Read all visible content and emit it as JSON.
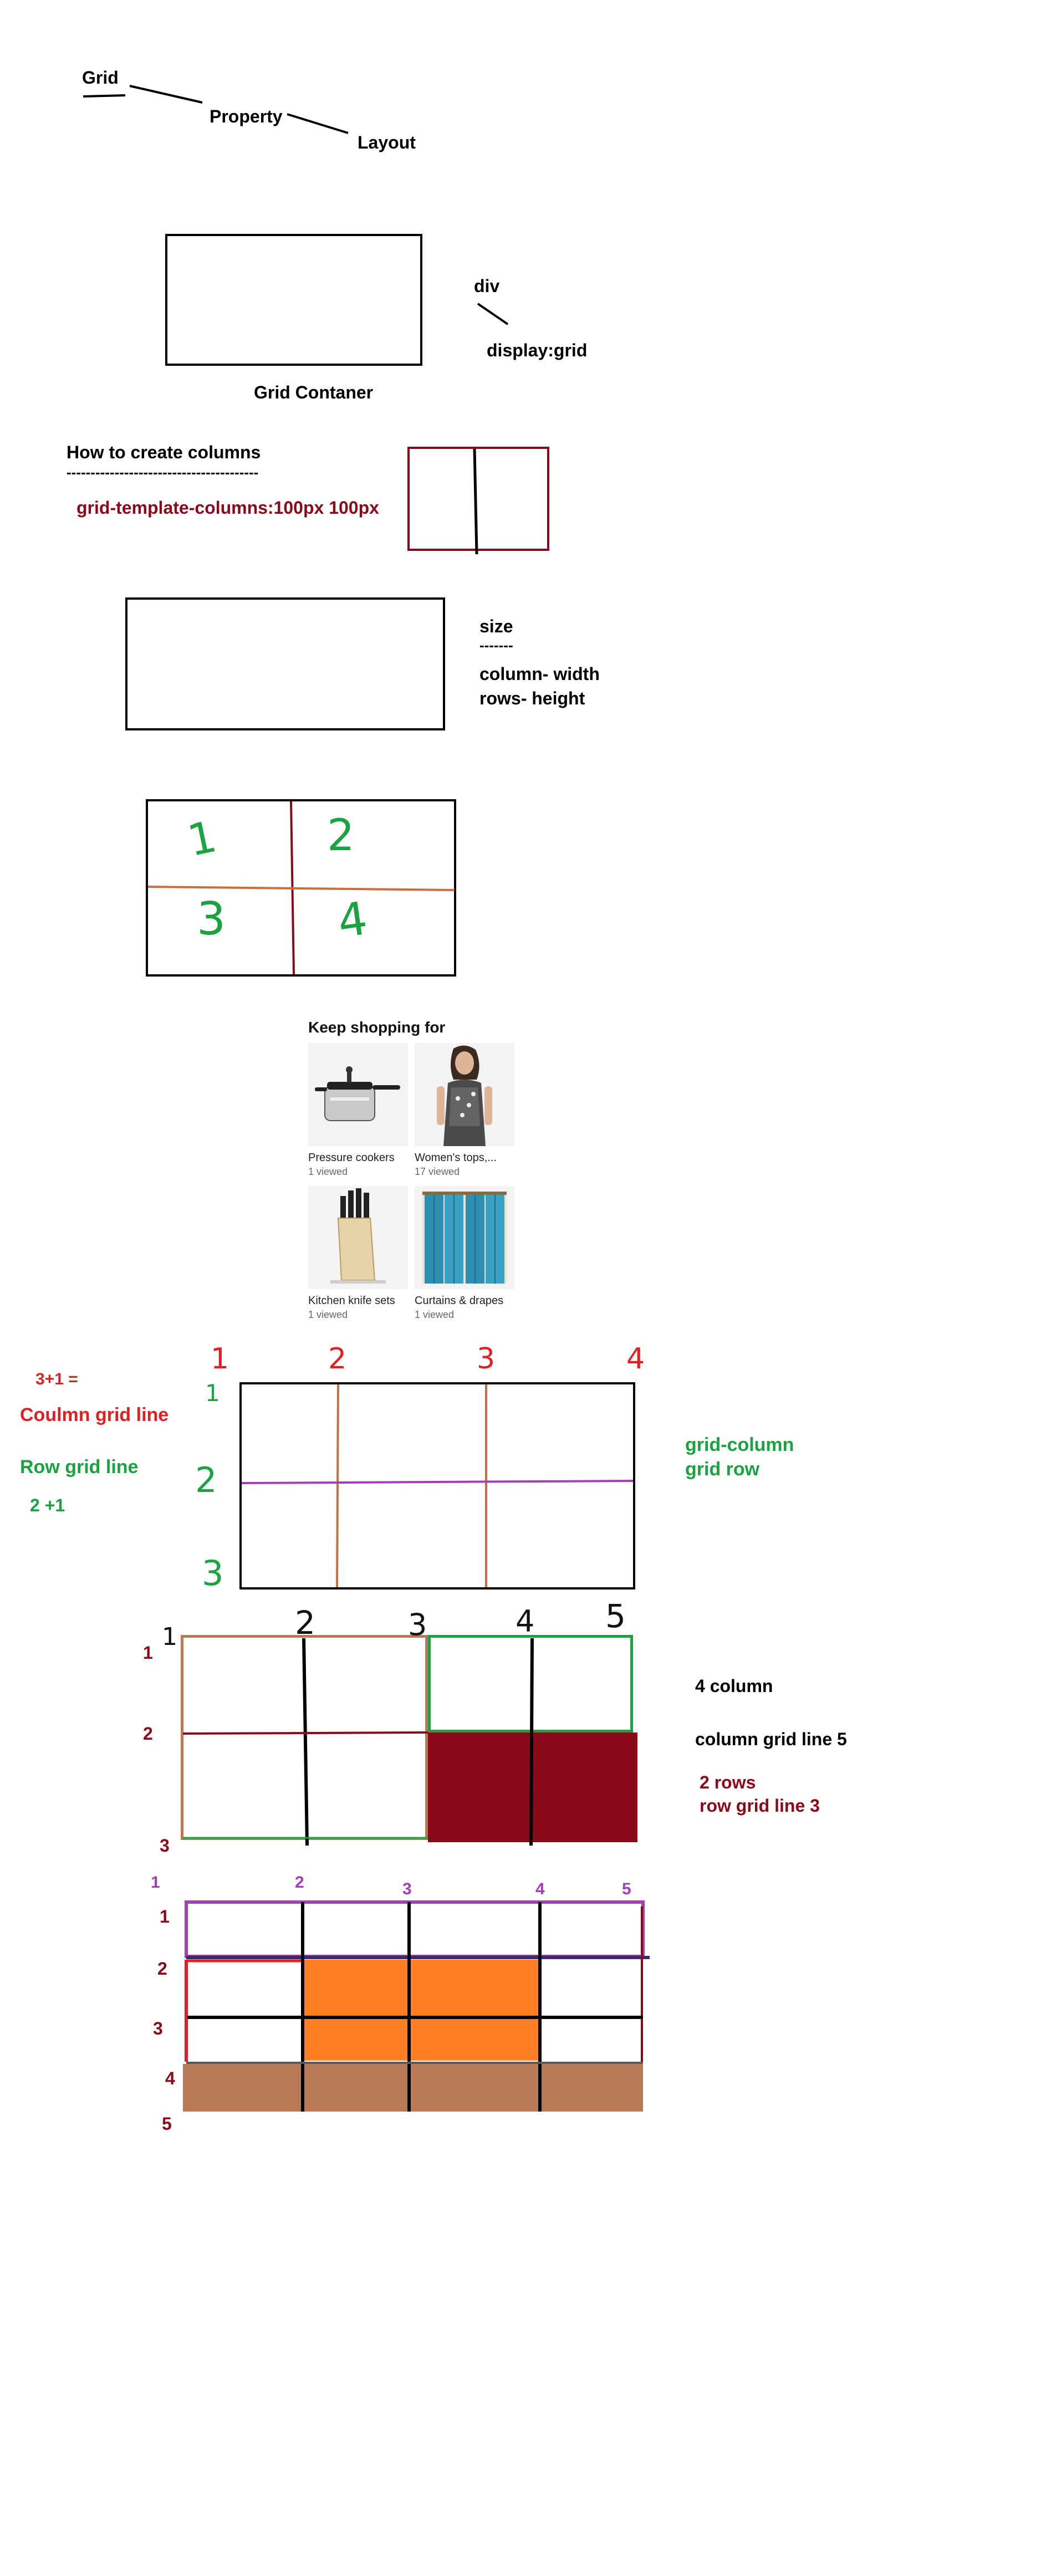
{
  "title_words": [
    "Grid",
    "Property",
    "Layout"
  ],
  "container": {
    "tag": "div",
    "css": "display:grid",
    "caption": "Grid Contaner"
  },
  "columns": {
    "heading": "How to create columns",
    "dashes": "----------------------------------------",
    "code": "grid-template-columns:100px 100px"
  },
  "size": {
    "heading": "size",
    "dashes": "-------",
    "col": "column- width",
    "row": "rows- height"
  },
  "numbered_cells": [
    "1",
    "2",
    "3",
    "4"
  ],
  "shopping": {
    "title": "Keep shopping for",
    "items": [
      {
        "label": "Pressure cookers",
        "meta": "1 viewed"
      },
      {
        "label": "Women's tops,...",
        "meta": "17 viewed"
      },
      {
        "label": "Kitchen knife sets",
        "meta": "1 viewed"
      },
      {
        "label": "Curtains & drapes",
        "meta": "1 viewed"
      }
    ]
  },
  "lines_section": {
    "formula_col": "3+1 =",
    "col_label": "Coulmn grid line",
    "row_label": "Row grid line",
    "formula_row": "2 +1",
    "right_col": "grid-column",
    "right_row": "grid row",
    "col_numbers": [
      "1",
      "2",
      "3",
      "4"
    ],
    "row_numbers": [
      "1",
      "2",
      "3"
    ]
  },
  "span_section": {
    "col_numbers": [
      "1",
      "2",
      "3",
      "4",
      "5"
    ],
    "row_numbers": [
      "1",
      "2",
      "3"
    ],
    "note_cols": "4 column",
    "note_col_line": "column grid line 5",
    "note_rows": "2 rows",
    "note_row_line": "row grid line 3"
  },
  "area_section": {
    "col_numbers": [
      "1",
      "2",
      "3",
      "4",
      "5"
    ],
    "row_numbers": [
      "1",
      "2",
      "3",
      "4",
      "5"
    ]
  },
  "colors": {
    "maroon": "#8b0a1a",
    "orange": "#ff8024",
    "brown": "#b97a57",
    "green": "#1aa340",
    "purple": "#a23fb5",
    "red": "#e02020"
  }
}
